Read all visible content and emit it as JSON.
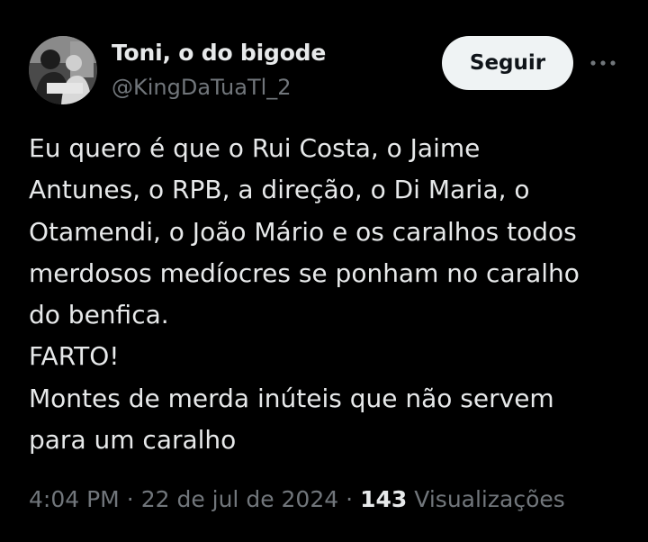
{
  "author": {
    "display_name": "Toni, o do bigode",
    "handle": "@KingDaTuaTl_2",
    "avatar_icon": "profile-photo"
  },
  "actions": {
    "follow_label": "Seguir",
    "more_icon": "more-horizontal-icon"
  },
  "tweet": {
    "lines": [
      "Eu quero é que o Rui Costa, o Jaime",
      "Antunes, o RPB, a direção, o Di Maria, o",
      "Otamendi, o João Mário e os caralhos todos",
      "merdosos medíocres se ponham no caralho",
      "do benfica.",
      "FARTO!",
      "Montes de merda inúteis que não servem",
      "para um caralho"
    ]
  },
  "meta": {
    "time": "4:04 PM",
    "separator": "·",
    "date": "22 de jul de 2024",
    "views_count": "143",
    "views_label": "Visualizações"
  },
  "colors": {
    "background": "#000000",
    "primary_text": "#e7e9ea",
    "secondary_text": "#71767b",
    "button_bg": "#eff3f4",
    "button_text": "#0f1419"
  }
}
